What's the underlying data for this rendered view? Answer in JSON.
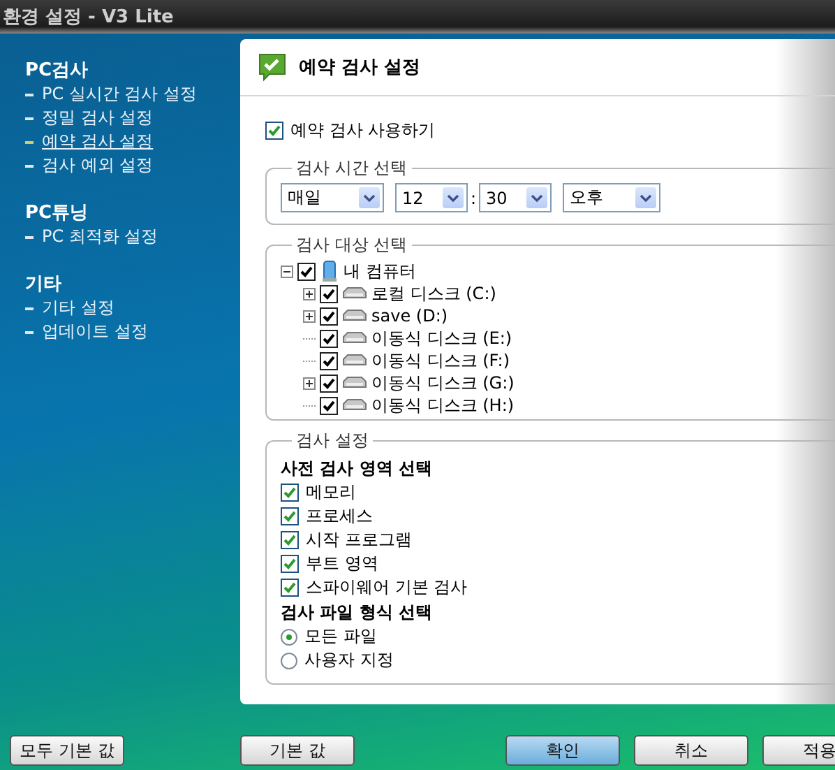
{
  "window": {
    "title": "환경 설정 - V3 Lite"
  },
  "sidebar": {
    "groups": [
      {
        "title": "PC검사",
        "items": [
          {
            "label": "PC 실시간 검사 설정",
            "selected": false
          },
          {
            "label": "정밀 검사 설정",
            "selected": false
          },
          {
            "label": "예약 검사 설정",
            "selected": true
          },
          {
            "label": "검사 예외 설정",
            "selected": false
          }
        ]
      },
      {
        "title": "PC튜닝",
        "items": [
          {
            "label": "PC 최적화 설정",
            "selected": false
          }
        ]
      },
      {
        "title": "기타",
        "items": [
          {
            "label": "기타 설정",
            "selected": false
          },
          {
            "label": "업데이트 설정",
            "selected": false
          }
        ]
      }
    ]
  },
  "panel": {
    "title": "예약 검사 설정",
    "enable": {
      "label": "예약 검사 사용하기",
      "checked": true
    },
    "time_group": {
      "legend": "검사 시간 선택",
      "fields": [
        {
          "kind": "select",
          "value": "매일"
        },
        {
          "kind": "select",
          "value": "12"
        },
        {
          "kind": "separator",
          "value": ":"
        },
        {
          "kind": "select",
          "value": "30"
        },
        {
          "kind": "select",
          "value": "오후"
        }
      ]
    },
    "target_group": {
      "legend": "검사 대상 선택",
      "tree": {
        "label": "내 컴퓨터",
        "kind": "computer",
        "has_children": true,
        "expanded": true,
        "checked": true,
        "children": [
          {
            "label": "로컬 디스크 (C:)",
            "kind": "drive",
            "has_children": true,
            "expanded": false,
            "checked": true
          },
          {
            "label": "save (D:)",
            "kind": "drive",
            "has_children": true,
            "expanded": false,
            "checked": true
          },
          {
            "label": "이동식 디스크 (E:)",
            "kind": "drive",
            "has_children": false,
            "checked": true
          },
          {
            "label": "이동식 디스크 (F:)",
            "kind": "drive",
            "has_children": false,
            "checked": true
          },
          {
            "label": "이동식 디스크 (G:)",
            "kind": "drive",
            "has_children": true,
            "expanded": false,
            "checked": true
          },
          {
            "label": "이동식 디스크 (H:)",
            "kind": "drive",
            "has_children": false,
            "checked": true
          }
        ]
      }
    },
    "scan_group": {
      "legend": "검사 설정",
      "sections": [
        {
          "heading": "사전 검사 영역 선택",
          "options": [
            {
              "kind": "checkbox",
              "label": "메모리",
              "checked": true
            },
            {
              "kind": "checkbox",
              "label": "프로세스",
              "checked": true
            },
            {
              "kind": "checkbox",
              "label": "시작 프로그램",
              "checked": true
            },
            {
              "kind": "checkbox",
              "label": "부트 영역",
              "checked": true
            },
            {
              "kind": "checkbox",
              "label": "스파이웨어 기본 검사",
              "checked": true
            }
          ]
        },
        {
          "heading": "검사 파일 형식 선택",
          "options": [
            {
              "kind": "radio",
              "label": "모든 파일",
              "selected": true
            },
            {
              "kind": "radio",
              "label": "사용자 지정",
              "selected": false
            }
          ]
        }
      ]
    }
  },
  "footer": {
    "reset_all": {
      "label": "모두 기본 값",
      "default": false
    },
    "panel_buttons": [
      {
        "label": "기본 값",
        "default": false
      }
    ],
    "dialog_buttons": [
      {
        "label": "확인",
        "default": true
      },
      {
        "label": "취소",
        "default": false
      },
      {
        "label": "적용",
        "default": false
      }
    ]
  }
}
